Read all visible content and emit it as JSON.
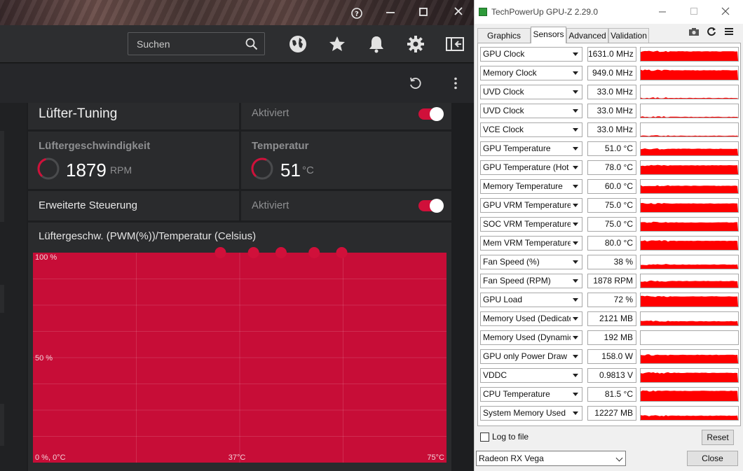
{
  "amd": {
    "search_placeholder": "Suchen",
    "fan_tuning": {
      "title": "Lüfter-Tuning",
      "status": "Aktiviert",
      "enabled": true
    },
    "fan_speed": {
      "label": "Lüftergeschwindigkeit",
      "value": "1879",
      "unit": "RPM"
    },
    "temperature": {
      "label": "Temperatur",
      "value": "51",
      "unit": "°C"
    },
    "advanced_control": {
      "title": "Erweiterte Steuerung",
      "status": "Aktiviert",
      "enabled": true
    },
    "accent_color": "#d0103a"
  },
  "chart_data": {
    "type": "area",
    "title": "Lüftergeschw. (PWM(%))/Temperatur (Celsius)",
    "y_tick_labels": [
      "100 %",
      "50 %",
      "0 %, 0°C"
    ],
    "x_tick_labels": [
      "37°C",
      "75°C"
    ],
    "xlim": [
      0,
      75
    ],
    "ylim": [
      0,
      100
    ],
    "grid": true,
    "control_points": [
      {
        "x": 34,
        "y": 100
      },
      {
        "x": 40,
        "y": 100
      },
      {
        "x": 45,
        "y": 100
      },
      {
        "x": 51,
        "y": 100
      },
      {
        "x": 56,
        "y": 100
      }
    ],
    "fill_color": "#c70d37"
  },
  "gpuz": {
    "title": "TechPowerUp GPU-Z 2.29.0",
    "tabs": [
      "Graphics Card",
      "Sensors",
      "Advanced",
      "Validation"
    ],
    "active_tab": "Sensors",
    "sensors": [
      {
        "name": "GPU Clock",
        "value": "1631.0 MHz",
        "level": 0.8
      },
      {
        "name": "Memory Clock",
        "value": "949.0 MHz",
        "level": 0.8
      },
      {
        "name": "UVD Clock",
        "value": "33.0 MHz",
        "level": 0.06
      },
      {
        "name": "UVD Clock",
        "value": "33.0 MHz",
        "level": 0.06
      },
      {
        "name": "VCE Clock",
        "value": "33.0 MHz",
        "level": 0.06
      },
      {
        "name": "GPU Temperature",
        "value": "51.0 °C",
        "level": 0.55
      },
      {
        "name": "GPU Temperature (Hot Spot)",
        "value": "78.0 °C",
        "level": 0.75
      },
      {
        "name": "Memory Temperature",
        "value": "60.0 °C",
        "level": 0.62
      },
      {
        "name": "GPU VRM Temperature",
        "value": "75.0 °C",
        "level": 0.72
      },
      {
        "name": "SOC VRM Temperature",
        "value": "75.0 °C",
        "level": 0.72
      },
      {
        "name": "Mem VRM Temperature",
        "value": "80.0 °C",
        "level": 0.75
      },
      {
        "name": "Fan Speed (%)",
        "value": "38 %",
        "level": 0.35
      },
      {
        "name": "Fan Speed (RPM)",
        "value": "1878 RPM",
        "level": 0.55
      },
      {
        "name": "GPU Load",
        "value": "72 %",
        "level": 0.85
      },
      {
        "name": "Memory Used (Dedicated)",
        "value": "2121 MB",
        "level": 0.35
      },
      {
        "name": "Memory Used (Dynamic)",
        "value": "192 MB",
        "level": 0.0
      },
      {
        "name": "GPU only Power Draw",
        "value": "158.0 W",
        "level": 0.7
      },
      {
        "name": "VDDC",
        "value": "0.9813 V",
        "level": 0.78
      },
      {
        "name": "CPU Temperature",
        "value": "81.5 °C",
        "level": 0.85
      },
      {
        "name": "System Memory Used",
        "value": "12227 MB",
        "level": 0.35
      }
    ],
    "log_to_file_label": "Log to file",
    "log_to_file_checked": false,
    "reset_label": "Reset",
    "device": "Radeon RX Vega",
    "close_label": "Close",
    "graph_color": "#ff0000"
  }
}
